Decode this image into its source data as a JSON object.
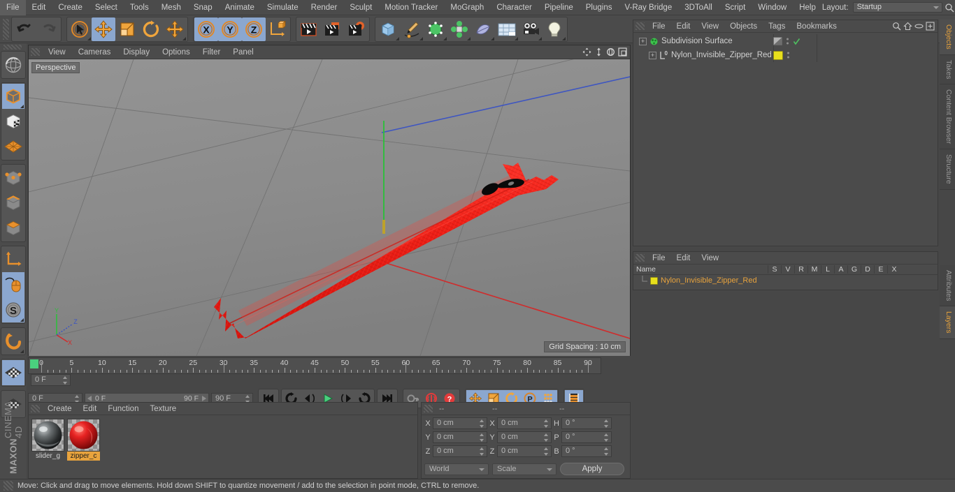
{
  "app": {
    "title": "CINEMA 4D",
    "brand_bold": "MAXON",
    "brand_light": "CINEMA 4D"
  },
  "menubar": {
    "items": [
      {
        "label": "File"
      },
      {
        "label": "Edit"
      },
      {
        "label": "Create"
      },
      {
        "label": "Select"
      },
      {
        "label": "Tools"
      },
      {
        "label": "Mesh"
      },
      {
        "label": "Snap"
      },
      {
        "label": "Animate"
      },
      {
        "label": "Simulate"
      },
      {
        "label": "Render"
      },
      {
        "label": "Sculpt"
      },
      {
        "label": "Motion Tracker"
      },
      {
        "label": "MoGraph"
      },
      {
        "label": "Character"
      },
      {
        "label": "Pipeline"
      },
      {
        "label": "Plugins"
      },
      {
        "label": "V-Ray Bridge"
      },
      {
        "label": "3DToAll"
      },
      {
        "label": "Script"
      },
      {
        "label": "Window"
      },
      {
        "label": "Help"
      }
    ],
    "layout_label": "Layout:",
    "layout_value": "Startup",
    "search_icon": "magnifier-icon"
  },
  "toolbar": {
    "groups": [
      {
        "buttons": [
          {
            "name": "undo-button",
            "icon": "undo-arrow-icon",
            "selected": false
          },
          {
            "name": "redo-button",
            "icon": "redo-arrow-icon",
            "selected": false
          }
        ]
      },
      {
        "buttons": [
          {
            "name": "live-selection-tool",
            "icon": "cursor-circle-icon",
            "selected": false
          },
          {
            "name": "move-tool",
            "icon": "move-arrows-icon",
            "selected": true
          },
          {
            "name": "scale-tool",
            "icon": "scale-box-icon",
            "selected": false
          },
          {
            "name": "rotate-tool",
            "icon": "rotate-circle-icon",
            "selected": false
          },
          {
            "name": "move-alt-tool",
            "icon": "move-arrows-icon",
            "selected": false
          }
        ]
      },
      {
        "buttons": [
          {
            "name": "x-axis-lock",
            "icon": "x-axis-icon",
            "selected": true
          },
          {
            "name": "y-axis-lock",
            "icon": "y-axis-icon",
            "selected": true
          },
          {
            "name": "z-axis-lock",
            "icon": "z-axis-icon",
            "selected": true
          },
          {
            "name": "world-object-coord-toggle",
            "icon": "axis-cube-icon",
            "selected": false
          }
        ]
      },
      {
        "buttons": [
          {
            "name": "render-view-button",
            "icon": "clapboard-icon",
            "selected": false
          },
          {
            "name": "render-region-button",
            "icon": "clapboard-region-icon",
            "selected": false
          },
          {
            "name": "render-settings-button",
            "icon": "clapboard-gear-icon",
            "selected": false
          }
        ]
      },
      {
        "buttons": [
          {
            "name": "add-cube-button",
            "icon": "cube-icon",
            "selected": false
          },
          {
            "name": "add-spline-button",
            "icon": "pen-spline-icon",
            "selected": false
          },
          {
            "name": "add-generator-button",
            "icon": "green-cube-icon",
            "selected": false
          },
          {
            "name": "add-mograph-button",
            "icon": "green-cluster-icon",
            "selected": false
          },
          {
            "name": "add-deformer-button",
            "icon": "bend-deformer-icon",
            "selected": false
          },
          {
            "name": "add-scene-object-button",
            "icon": "floor-grid-icon",
            "selected": false
          },
          {
            "name": "add-camera-button",
            "icon": "camera-icon",
            "selected": false
          },
          {
            "name": "add-light-button",
            "icon": "light-bulb-icon",
            "selected": false
          }
        ]
      }
    ]
  },
  "left_toolbar": {
    "groups": [
      {
        "buttons": [
          {
            "name": "undo-view-button",
            "icon": "globe-sphere-icon",
            "selected": false
          }
        ]
      },
      {
        "buttons": [
          {
            "name": "model-mode-button",
            "icon": "model-cube-icon",
            "selected": true
          },
          {
            "name": "texture-mode-button",
            "icon": "checker-cube-icon",
            "selected": false
          },
          {
            "name": "workplane-mode-button",
            "icon": "grid-plane-icon",
            "selected": false
          }
        ]
      },
      {
        "buttons": [
          {
            "name": "points-mode-button",
            "icon": "points-cube-icon",
            "selected": false
          },
          {
            "name": "edges-mode-button",
            "icon": "edges-cube-icon",
            "selected": false
          },
          {
            "name": "polygons-mode-button",
            "icon": "polygon-cube-icon",
            "selected": false
          }
        ]
      },
      {
        "buttons": [
          {
            "name": "axis-modify-button",
            "icon": "axis-l-icon",
            "selected": false
          },
          {
            "name": "enable-snapping-button",
            "icon": "mouse-icon",
            "selected": true
          },
          {
            "name": "viewport-solo-button",
            "icon": "s-sphere-icon",
            "selected": true
          }
        ]
      },
      {
        "buttons": [
          {
            "name": "magnet-button",
            "icon": "magnet-icon",
            "selected": false
          }
        ]
      },
      {
        "buttons": [
          {
            "name": "workplane-lock-button",
            "icon": "checker-plane-icon",
            "selected": true
          }
        ]
      },
      {
        "buttons": [
          {
            "name": "workplane-align-button",
            "icon": "checker-diamond-icon",
            "selected": false
          }
        ]
      }
    ]
  },
  "viewport": {
    "menu": [
      {
        "label": "View"
      },
      {
        "label": "Cameras"
      },
      {
        "label": "Display"
      },
      {
        "label": "Options"
      },
      {
        "label": "Filter"
      },
      {
        "label": "Panel"
      }
    ],
    "nav_icons": [
      {
        "name": "pan-view-icon"
      },
      {
        "name": "zoom-view-icon"
      },
      {
        "name": "rotate-view-icon"
      },
      {
        "name": "maximize-view-icon"
      }
    ],
    "label": "Perspective",
    "grid_spacing": "Grid Spacing : 10 cm",
    "axis_labels": {
      "x": "X",
      "y": "Y",
      "z": "Z"
    },
    "model_description": "Red nylon invisible zipper with black pull tab",
    "model_color": "#ee2222",
    "pull_color": "#0a0a0a"
  },
  "timeline": {
    "ticks": [
      0,
      5,
      10,
      15,
      20,
      25,
      30,
      35,
      40,
      45,
      50,
      55,
      60,
      65,
      70,
      75,
      80,
      85,
      90
    ],
    "min_frame": 0,
    "max_frame": 90,
    "current_frame_field": "0 F",
    "right_frame_field": "0 F",
    "range_start": "0 F",
    "range_end": "90 F",
    "end_frame_field": "90 F",
    "transport": [
      {
        "name": "go-to-start-button",
        "icon": "skip-start-icon",
        "selected": false
      },
      {
        "name": "play-backwards-button",
        "icon": "rewind-loop-icon",
        "selected": false
      },
      {
        "name": "step-back-button",
        "icon": "step-back-icon",
        "selected": false
      },
      {
        "name": "play-button",
        "icon": "play-icon",
        "selected": false
      },
      {
        "name": "step-forward-button",
        "icon": "step-forward-icon",
        "selected": false
      },
      {
        "name": "loop-button",
        "icon": "loop-arrow-icon",
        "selected": false
      },
      {
        "name": "go-to-end-button",
        "icon": "skip-end-icon",
        "selected": false
      }
    ],
    "record_controls": [
      {
        "name": "record-key-button",
        "icon": "key-icon",
        "selected": false
      },
      {
        "name": "autokey-button",
        "icon": "autokey-circle-icon",
        "selected": false
      },
      {
        "name": "keyframe-selection-button",
        "icon": "question-circle-icon",
        "selected": false
      }
    ],
    "key_filters": [
      {
        "name": "record-position-button",
        "icon": "move-arrows-icon",
        "selected": true
      },
      {
        "name": "record-scale-button",
        "icon": "scale-box-icon",
        "selected": true
      },
      {
        "name": "record-rotation-button",
        "icon": "rotate-circle-icon",
        "selected": true
      },
      {
        "name": "record-parameter-button",
        "icon": "p-circle-icon",
        "selected": true
      },
      {
        "name": "record-pla-button",
        "icon": "point-dots-icon",
        "selected": true
      }
    ],
    "extra": [
      {
        "name": "timeline-view-button",
        "icon": "filmstrip-icon",
        "selected": true
      }
    ]
  },
  "material_manager": {
    "menu": [
      {
        "label": "Create"
      },
      {
        "label": "Edit"
      },
      {
        "label": "Function"
      },
      {
        "label": "Texture"
      }
    ],
    "materials": [
      {
        "name": "slider_g",
        "color": "#555a5c",
        "selected": false
      },
      {
        "name": "zipper_c",
        "color": "#d81f1f",
        "selected": true
      }
    ]
  },
  "coordinate_manager": {
    "headers": [
      "--",
      "--",
      "--"
    ],
    "position": {
      "labels": [
        "X",
        "Y",
        "Z"
      ],
      "values": [
        "0 cm",
        "0 cm",
        "0 cm"
      ]
    },
    "size": {
      "labels": [
        "X",
        "Y",
        "Z"
      ],
      "values": [
        "0 cm",
        "0 cm",
        "0 cm"
      ]
    },
    "rotation": {
      "labels": [
        "H",
        "P",
        "B"
      ],
      "values": [
        "0 °",
        "0 °",
        "0 °"
      ]
    },
    "coord_system": "World",
    "mode": "Scale",
    "apply_label": "Apply"
  },
  "object_manager": {
    "menu": [
      {
        "label": "File"
      },
      {
        "label": "Edit"
      },
      {
        "label": "View"
      },
      {
        "label": "Objects"
      },
      {
        "label": "Tags"
      },
      {
        "label": "Bookmarks"
      }
    ],
    "header_icons": [
      {
        "name": "search-icon"
      },
      {
        "name": "home-icon"
      },
      {
        "name": "ellipse-icon"
      },
      {
        "name": "add-panel-icon"
      }
    ],
    "objects": [
      {
        "name": "Subdivision Surface",
        "icon": "subdivision-surface-icon",
        "depth": 0,
        "has_tag": true,
        "tag_color": "#9a9a9a",
        "checked": true
      },
      {
        "name": "Nylon_Invisible_Zipper_Red",
        "icon": "polygon-object-icon",
        "depth": 1,
        "has_tag": true,
        "tag_color": "#e8e01c",
        "checked": false
      }
    ]
  },
  "layer_manager": {
    "menu": [
      {
        "label": "File"
      },
      {
        "label": "Edit"
      },
      {
        "label": "View"
      }
    ],
    "columns": [
      "Name",
      "S",
      "V",
      "R",
      "M",
      "L",
      "A",
      "G",
      "D",
      "E",
      "X"
    ],
    "rows": [
      {
        "name": "Nylon_Invisible_Zipper_Red",
        "color": "#e8e01c",
        "text_color": "#e8a33d"
      }
    ]
  },
  "right_tabs": {
    "top": [
      {
        "label": "Objects",
        "active": true
      },
      {
        "label": "Takes",
        "active": false
      },
      {
        "label": "Content Browser",
        "active": false
      },
      {
        "label": "Structure",
        "active": false
      }
    ],
    "bottom": [
      {
        "label": "Attributes",
        "active": false
      },
      {
        "label": "Layers",
        "active": true
      }
    ]
  },
  "statusbar": {
    "text": "Move: Click and drag to move elements. Hold down SHIFT to quantize movement / add to the selection in point mode, CTRL to remove."
  }
}
